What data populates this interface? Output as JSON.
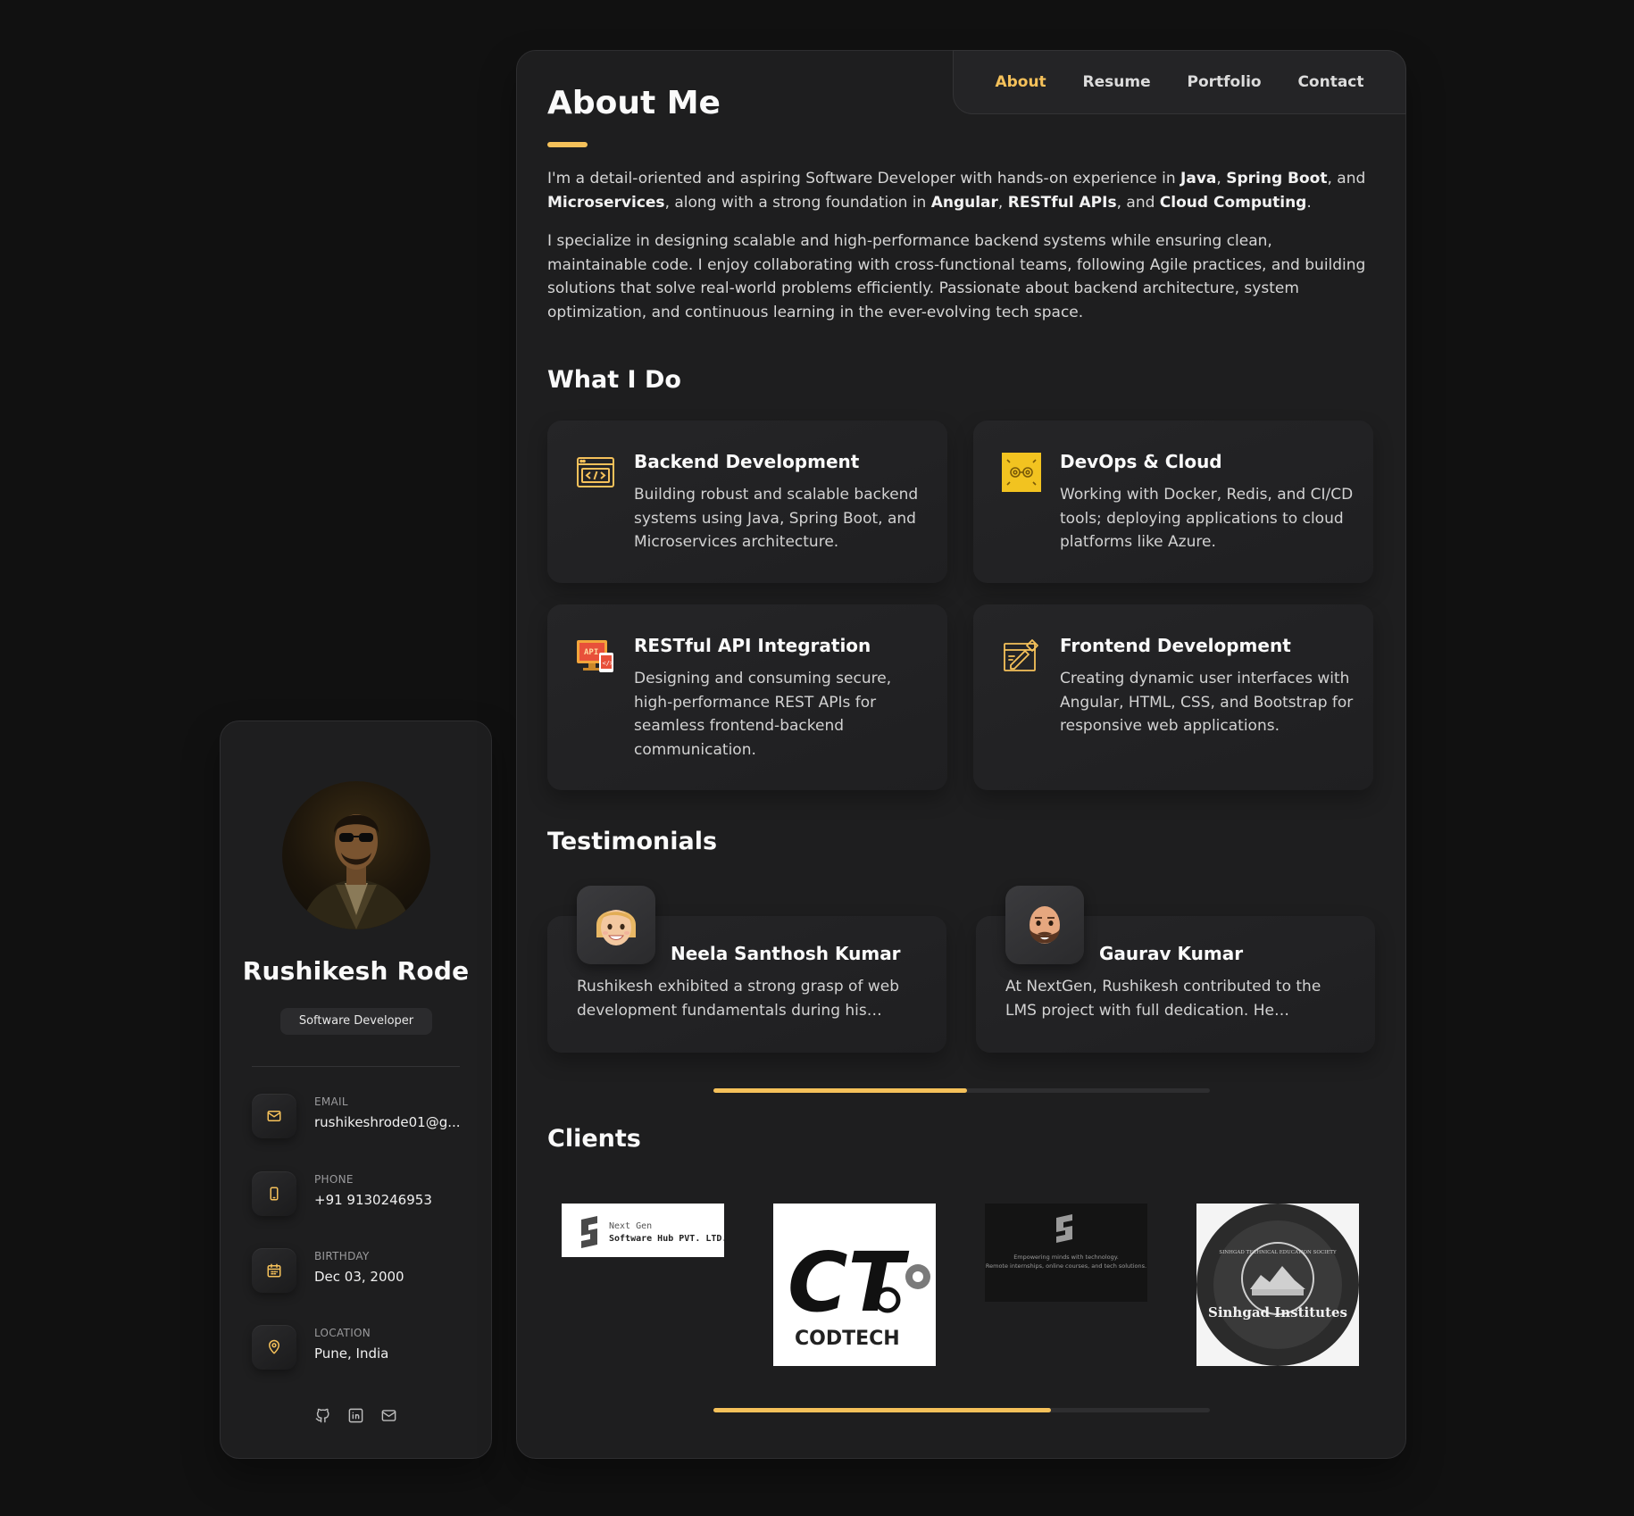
{
  "sidebar": {
    "name": "Rushikesh Rode",
    "role": "Software Developer",
    "contacts": [
      {
        "label": "EMAIL",
        "value": "rushikeshrode01@g...",
        "icon": "mail-icon"
      },
      {
        "label": "PHONE",
        "value": "+91 9130246953",
        "icon": "phone-icon"
      },
      {
        "label": "BIRTHDAY",
        "value": "Dec 03, 2000",
        "icon": "calendar-icon"
      },
      {
        "label": "LOCATION",
        "value": "Pune, India",
        "icon": "location-pin-icon"
      }
    ],
    "socials": [
      "github-icon",
      "linkedin-icon",
      "mail-icon"
    ]
  },
  "nav": {
    "items": [
      "About",
      "Resume",
      "Portfolio",
      "Contact"
    ],
    "active": "About"
  },
  "about": {
    "title": "About Me",
    "p1_parts": [
      "I'm a detail-oriented and aspiring Software Developer with hands-on experience in ",
      "Java",
      ", ",
      "Spring Boot",
      ", and ",
      "Microservices",
      ", along with a strong foundation in ",
      "Angular",
      ", ",
      "RESTful APIs",
      ", and ",
      "Cloud Computing",
      "."
    ],
    "p2": "I specialize in designing scalable and high-performance backend systems while ensuring clean, maintainable code. I enjoy collaborating with cross-functional teams, following Agile practices, and building solutions that solve real-world problems efficiently. Passionate about backend architecture, system optimization, and continuous learning in the ever-evolving tech space."
  },
  "services": {
    "title": "What I Do",
    "items": [
      {
        "title": "Backend Development",
        "text": "Building robust and scalable backend systems using Java, Spring Boot, and Microservices architecture.",
        "icon": "code-window-icon"
      },
      {
        "title": "DevOps & Cloud",
        "text": "Working with Docker, Redis, and CI/CD tools; deploying applications to cloud platforms like Azure.",
        "icon": "devops-icon"
      },
      {
        "title": "RESTful API Integration",
        "text": "Designing and consuming secure, high-performance REST APIs for seamless frontend-backend communication.",
        "icon": "api-icon"
      },
      {
        "title": "Frontend Development",
        "text": "Creating dynamic user interfaces with Angular, HTML, CSS, and Bootstrap for responsive web applications.",
        "icon": "design-icon"
      }
    ]
  },
  "testimonials": {
    "title": "Testimonials",
    "items": [
      {
        "name": "Neela Santhosh Kumar",
        "text": "Rushikesh exhibited a strong grasp of web development fundamentals during his…"
      },
      {
        "name": "Gaurav Kumar",
        "text": "At NextGen, Rushikesh contributed to the LMS project with full dedication. He developed…"
      }
    ],
    "scroll_progress": 0.51
  },
  "clients": {
    "title": "Clients",
    "logos": [
      {
        "name": "next-gen-logo",
        "line1": "Next Gen",
        "line2": "Software Hub PVT. LTD."
      },
      {
        "name": "codtech-logo",
        "line1": "CT",
        "line2": "CODTECH"
      },
      {
        "name": "next-gen-dark-logo",
        "line1": "Empowering minds with technology.",
        "line2": "Remote internships, online courses, and tech solutions."
      },
      {
        "name": "sinhgad-logo",
        "line1": "Sinhgad Institutes",
        "line2": "SINHGAD TECHNICAL EDUCATION SOCIETY"
      }
    ],
    "scroll_progress": 0.68
  },
  "colors": {
    "accent": "#f5c15a",
    "background": "#111111",
    "card": "#1e1e1f"
  }
}
